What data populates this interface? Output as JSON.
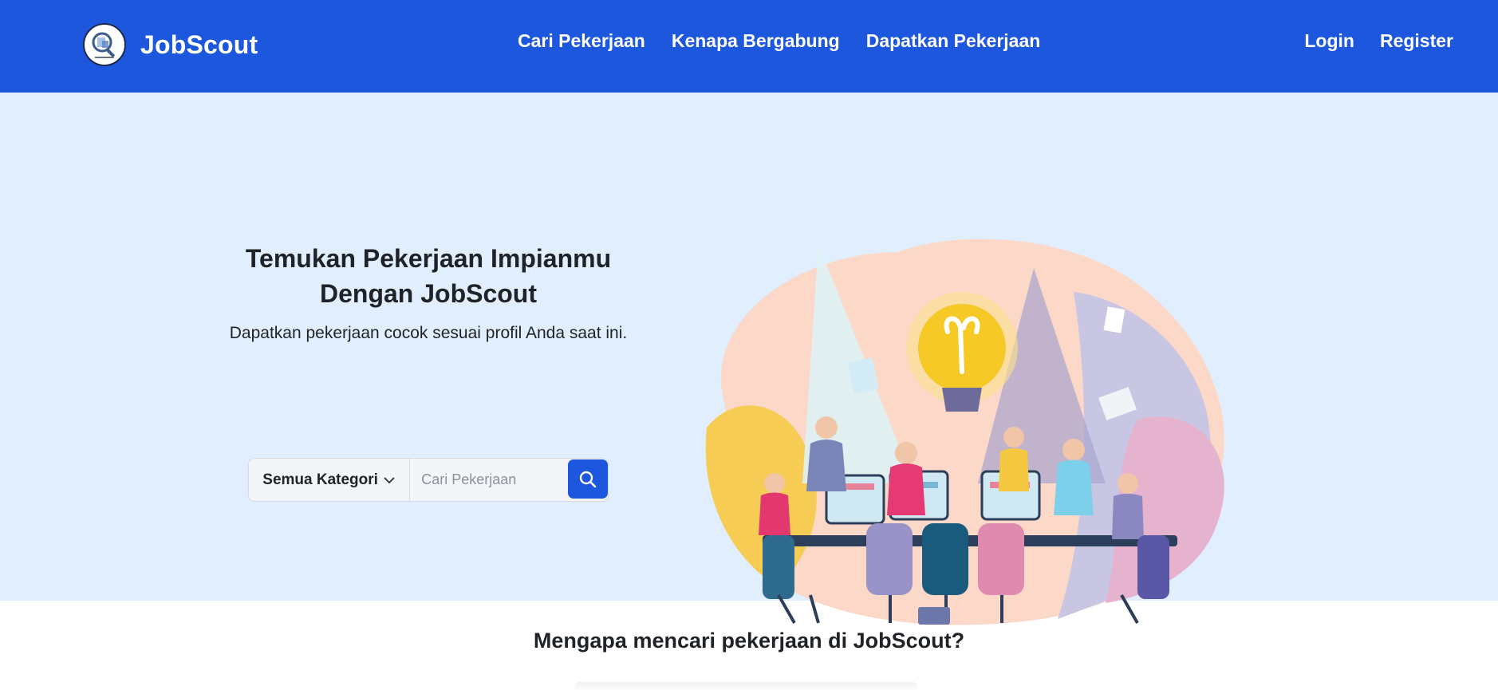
{
  "navbar": {
    "brand": "JobScout",
    "links": [
      "Cari Pekerjaan",
      "Kenapa Bergabung",
      "Dapatkan Pekerjaan"
    ],
    "auth": {
      "login": "Login",
      "register": "Register"
    },
    "color": "#1c57de"
  },
  "hero": {
    "title_line1": "Temukan Pekerjaan Impianmu",
    "title_line2": "Dengan JobScout",
    "subtitle": "Dapatkan pekerjaan cocok sesuai profil Anda saat ini.",
    "background": "#e0eefd",
    "search": {
      "category": "Semua Kategori",
      "placeholder": "Cari Pekerjaan",
      "button_icon": "search-icon"
    }
  },
  "section": {
    "title": "Mengapa mencari pekerjaan di JobScout?"
  }
}
